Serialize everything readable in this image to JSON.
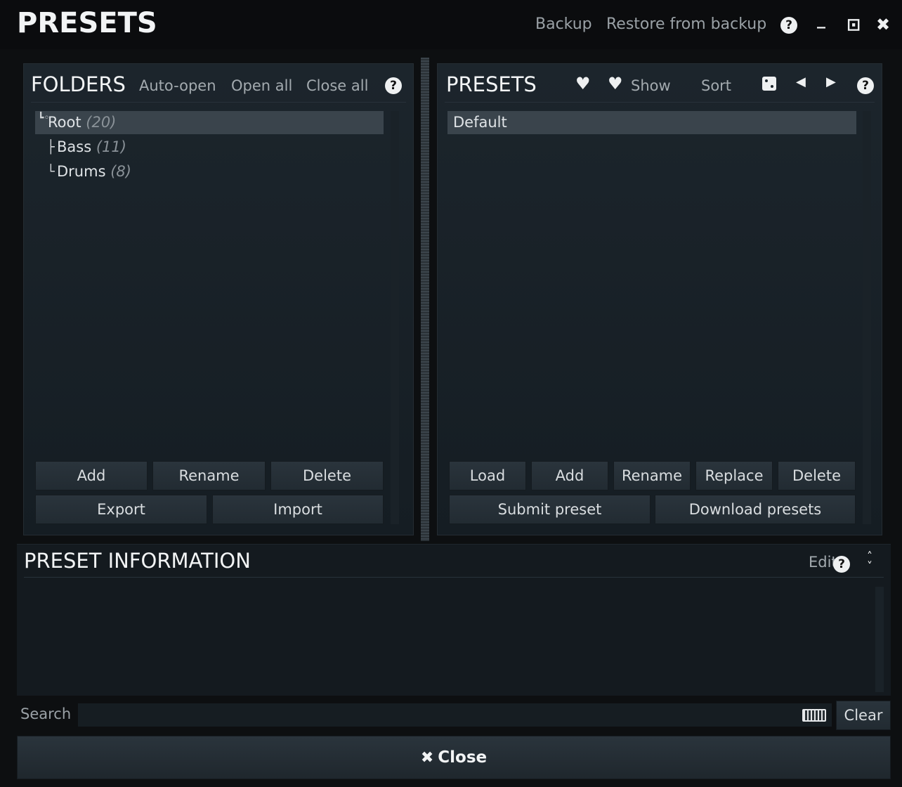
{
  "window": {
    "title": "PRESETS",
    "backup_label": "Backup",
    "restore_label": "Restore from backup",
    "help_glyph": "?",
    "minimize_glyph": "_",
    "fullscreen_glyph": "⊡",
    "close_glyph": "✖"
  },
  "folders": {
    "title": "FOLDERS",
    "auto_open": "Auto-open",
    "open_all": "Open all",
    "close_all": "Close all",
    "items": [
      {
        "label": "Root",
        "count": "(20)"
      },
      {
        "label": "Bass",
        "count": "(11)"
      },
      {
        "label": "Drums",
        "count": "(8)"
      }
    ],
    "buttons": {
      "add": "Add",
      "rename": "Rename",
      "delete": "Delete",
      "export": "Export",
      "import": "Import"
    }
  },
  "presets": {
    "title": "PRESETS",
    "show": "Show",
    "sort": "Sort",
    "items": [
      "Default"
    ],
    "buttons": {
      "load": "Load",
      "add": "Add",
      "rename": "Rename",
      "replace": "Replace",
      "delete": "Delete",
      "submit": "Submit preset",
      "download": "Download presets"
    }
  },
  "info": {
    "title": "PRESET INFORMATION",
    "edit": "Edit"
  },
  "search": {
    "label": "Search",
    "value": "",
    "clear": "Clear"
  },
  "close_button": "Close",
  "colors": {
    "accent": "#f2f4f5",
    "background": "#0d0f11",
    "panel": "#1c252c"
  }
}
